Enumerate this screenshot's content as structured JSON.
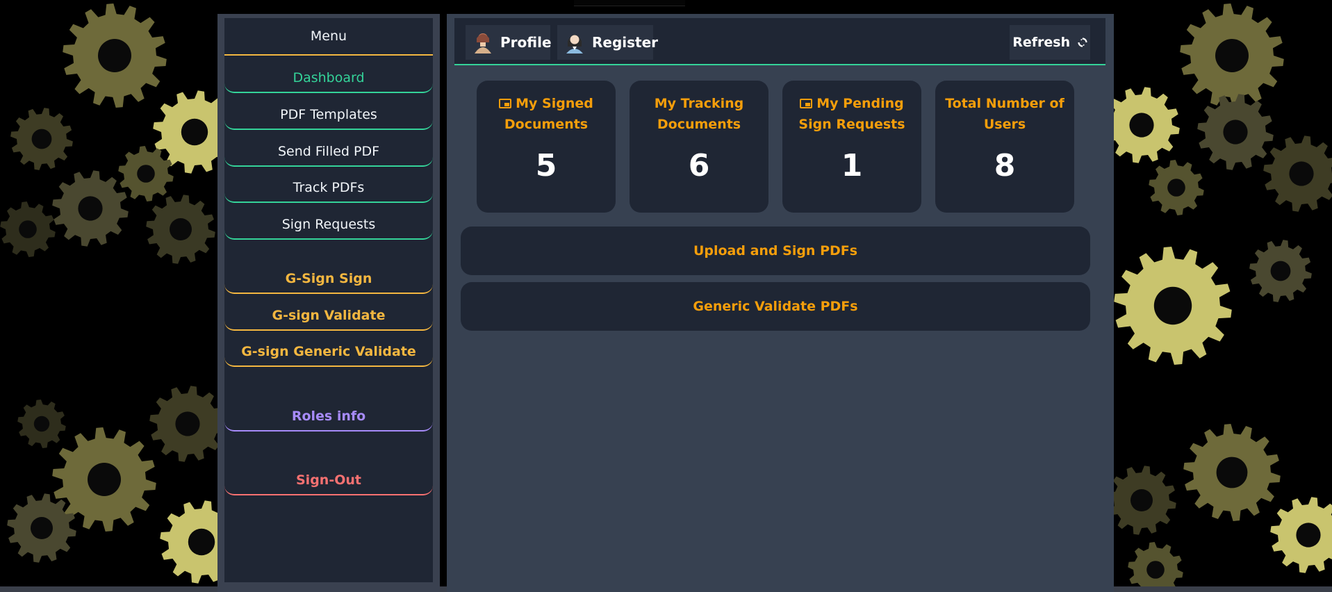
{
  "sidebar": {
    "title": "Menu",
    "items": [
      {
        "label": "Dashboard"
      },
      {
        "label": "PDF Templates"
      },
      {
        "label": "Send Filled PDF"
      },
      {
        "label": "Track PDFs"
      },
      {
        "label": "Sign Requests"
      }
    ],
    "gsign": [
      {
        "label": "G-Sign Sign"
      },
      {
        "label": "G-sign Validate"
      },
      {
        "label": "G-sign Generic Validate"
      }
    ],
    "roles_label": "Roles info",
    "signout_label": "Sign-Out"
  },
  "header": {
    "profile_label": "Profile",
    "register_label": "Register",
    "refresh_label": "Refresh"
  },
  "cards": [
    {
      "title": "My Signed Documents",
      "value": "5"
    },
    {
      "title": "My Tracking Documents",
      "value": "6"
    },
    {
      "title": "My Pending Sign Requests",
      "value": "1"
    },
    {
      "title": "Total Number of Users",
      "value": "8"
    }
  ],
  "actions": {
    "upload_label": "Upload and Sign PDFs",
    "validate_label": "Generic Validate PDFs"
  },
  "colors": {
    "accent_green": "#34d399",
    "accent_gold": "#f4b740",
    "accent_orange": "#f59e0b",
    "accent_purple": "#a78bfa",
    "accent_red": "#f87171",
    "panel": "#1f2634"
  },
  "icons": {
    "refresh": "refresh-icon",
    "inbox": "inbox-icon",
    "avatar": "avatar-icon"
  }
}
